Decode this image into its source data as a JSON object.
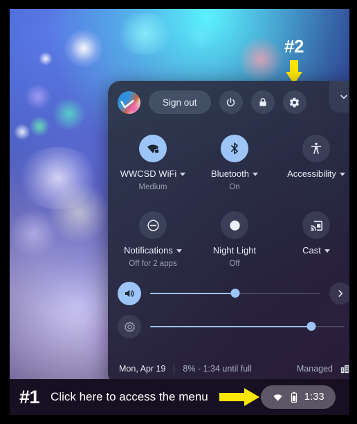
{
  "annotations": {
    "step1": {
      "number": "#1",
      "text": "Click here to access the menu"
    },
    "step2": {
      "number": "#2"
    }
  },
  "status_pill": {
    "time": "1:33",
    "wifi_icon": "wifi-icon",
    "battery_icon": "battery-icon"
  },
  "tray": {
    "top_row": {
      "avatar": "user-avatar",
      "sign_out_label": "Sign out",
      "power_icon": "power-icon",
      "lock_icon": "lock-icon",
      "settings_icon": "gear-icon",
      "collapse_icon": "chevron-down-icon"
    },
    "pods": [
      {
        "id": "wifi",
        "icon": "wifi-locked-icon",
        "label": "WWCSD WiFi",
        "sublabel": "Medium",
        "caret": true,
        "active": true
      },
      {
        "id": "bluetooth",
        "icon": "bluetooth-icon",
        "label": "Bluetooth",
        "sublabel": "On",
        "caret": true,
        "active": true
      },
      {
        "id": "accessibility",
        "icon": "accessibility-icon",
        "label": "Accessibility",
        "sublabel": "",
        "caret": true,
        "active": false
      },
      {
        "id": "notifications",
        "icon": "do-not-disturb-icon",
        "label": "Notifications",
        "sublabel": "Off for 2 apps",
        "caret": true,
        "active": false
      },
      {
        "id": "nightlight",
        "icon": "moon-icon",
        "label": "Night Light",
        "sublabel": "Off",
        "caret": false,
        "active": false
      },
      {
        "id": "cast",
        "icon": "cast-icon",
        "label": "Cast",
        "sublabel": "",
        "caret": true,
        "active": false
      }
    ],
    "sliders": [
      {
        "id": "volume",
        "icon": "volume-icon",
        "value": 50,
        "active": true
      },
      {
        "id": "brightness",
        "icon": "brightness-icon",
        "value": 83,
        "active": false
      }
    ],
    "volume_expand_icon": "chevron-right-icon",
    "footer": {
      "date": "Mon, Apr 19",
      "battery": "8% - 1:34 until full",
      "managed_label": "Managed",
      "managed_icon": "enterprise-building-icon"
    }
  },
  "colors": {
    "accent": "#9cc4f6",
    "arrow_yellow": "#ffe600",
    "tray_bg": "#2b2f48",
    "annotation_bar_bg": "#171022"
  }
}
